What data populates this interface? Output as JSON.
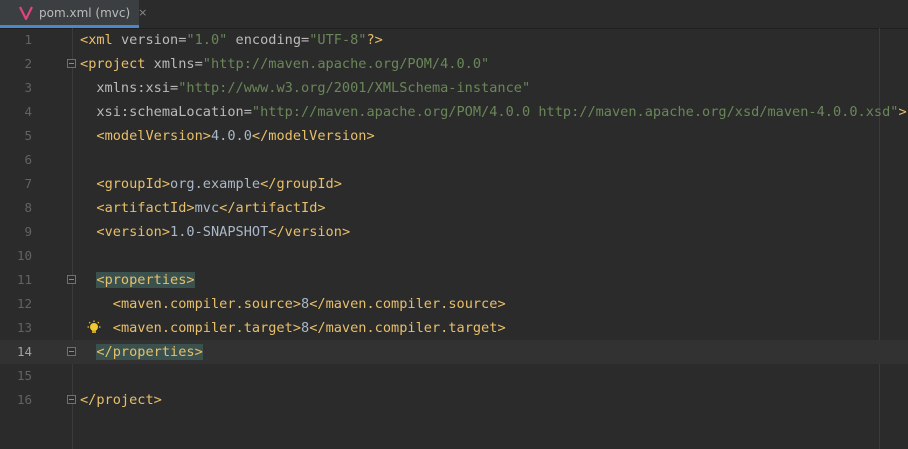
{
  "tab": {
    "label": "pom.xml (mvc)",
    "close": "×"
  },
  "lines": [
    {
      "n": "1",
      "code": "<?xml version=\"1.0\" encoding=\"UTF-8\"?>"
    },
    {
      "n": "2",
      "code": "<project xmlns=\"http://maven.apache.org/POM/4.0.0\""
    },
    {
      "n": "3",
      "code": "  xmlns:xsi=\"http://www.w3.org/2001/XMLSchema-instance\""
    },
    {
      "n": "4",
      "code": "  xsi:schemaLocation=\"http://maven.apache.org/POM/4.0.0 http://maven.apache.org/xsd/maven-4.0.0.xsd\">"
    },
    {
      "n": "5",
      "code": "  <modelVersion>4.0.0</modelVersion>"
    },
    {
      "n": "6",
      "code": ""
    },
    {
      "n": "7",
      "code": "  <groupId>org.example</groupId>"
    },
    {
      "n": "8",
      "code": "  <artifactId>mvc</artifactId>"
    },
    {
      "n": "9",
      "code": "  <version>1.0-SNAPSHOT</version>"
    },
    {
      "n": "10",
      "code": ""
    },
    {
      "n": "11",
      "code": "  <properties>"
    },
    {
      "n": "12",
      "code": "    <maven.compiler.source>8</maven.compiler.source>"
    },
    {
      "n": "13",
      "code": "    <maven.compiler.target>8</maven.compiler.target>"
    },
    {
      "n": "14",
      "code": "  </properties>"
    },
    {
      "n": "15",
      "code": ""
    },
    {
      "n": "16",
      "code": "</project>"
    }
  ],
  "current_line": "14",
  "colors": {
    "background": "#2b2b2b",
    "tag": "#e8bf6a",
    "attribute": "#bababa",
    "string": "#6a8759",
    "text": "#a9b7c6",
    "matched_tag_highlight": "#3b514d",
    "tab_accent": "#4a88c7"
  },
  "icons": {
    "tab": "vue-file-icon",
    "gutter_line_13": "lightbulb-icon"
  }
}
